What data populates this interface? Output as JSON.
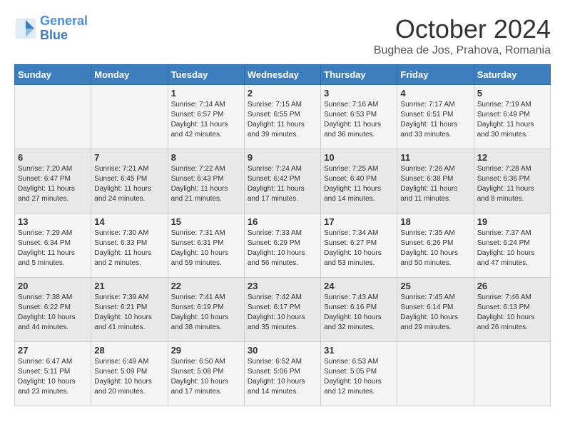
{
  "logo": {
    "line1": "General",
    "line2": "Blue"
  },
  "title": "October 2024",
  "subtitle": "Bughea de Jos, Prahova, Romania",
  "days_header": [
    "Sunday",
    "Monday",
    "Tuesday",
    "Wednesday",
    "Thursday",
    "Friday",
    "Saturday"
  ],
  "weeks": [
    [
      {
        "day": "",
        "info": ""
      },
      {
        "day": "",
        "info": ""
      },
      {
        "day": "1",
        "info": "Sunrise: 7:14 AM\nSunset: 6:57 PM\nDaylight: 11 hours and 42 minutes."
      },
      {
        "day": "2",
        "info": "Sunrise: 7:15 AM\nSunset: 6:55 PM\nDaylight: 11 hours and 39 minutes."
      },
      {
        "day": "3",
        "info": "Sunrise: 7:16 AM\nSunset: 6:53 PM\nDaylight: 11 hours and 36 minutes."
      },
      {
        "day": "4",
        "info": "Sunrise: 7:17 AM\nSunset: 6:51 PM\nDaylight: 11 hours and 33 minutes."
      },
      {
        "day": "5",
        "info": "Sunrise: 7:19 AM\nSunset: 6:49 PM\nDaylight: 11 hours and 30 minutes."
      }
    ],
    [
      {
        "day": "6",
        "info": "Sunrise: 7:20 AM\nSunset: 6:47 PM\nDaylight: 11 hours and 27 minutes."
      },
      {
        "day": "7",
        "info": "Sunrise: 7:21 AM\nSunset: 6:45 PM\nDaylight: 11 hours and 24 minutes."
      },
      {
        "day": "8",
        "info": "Sunrise: 7:22 AM\nSunset: 6:43 PM\nDaylight: 11 hours and 21 minutes."
      },
      {
        "day": "9",
        "info": "Sunrise: 7:24 AM\nSunset: 6:42 PM\nDaylight: 11 hours and 17 minutes."
      },
      {
        "day": "10",
        "info": "Sunrise: 7:25 AM\nSunset: 6:40 PM\nDaylight: 11 hours and 14 minutes."
      },
      {
        "day": "11",
        "info": "Sunrise: 7:26 AM\nSunset: 6:38 PM\nDaylight: 11 hours and 11 minutes."
      },
      {
        "day": "12",
        "info": "Sunrise: 7:28 AM\nSunset: 6:36 PM\nDaylight: 11 hours and 8 minutes."
      }
    ],
    [
      {
        "day": "13",
        "info": "Sunrise: 7:29 AM\nSunset: 6:34 PM\nDaylight: 11 hours and 5 minutes."
      },
      {
        "day": "14",
        "info": "Sunrise: 7:30 AM\nSunset: 6:33 PM\nDaylight: 11 hours and 2 minutes."
      },
      {
        "day": "15",
        "info": "Sunrise: 7:31 AM\nSunset: 6:31 PM\nDaylight: 10 hours and 59 minutes."
      },
      {
        "day": "16",
        "info": "Sunrise: 7:33 AM\nSunset: 6:29 PM\nDaylight: 10 hours and 56 minutes."
      },
      {
        "day": "17",
        "info": "Sunrise: 7:34 AM\nSunset: 6:27 PM\nDaylight: 10 hours and 53 minutes."
      },
      {
        "day": "18",
        "info": "Sunrise: 7:35 AM\nSunset: 6:26 PM\nDaylight: 10 hours and 50 minutes."
      },
      {
        "day": "19",
        "info": "Sunrise: 7:37 AM\nSunset: 6:24 PM\nDaylight: 10 hours and 47 minutes."
      }
    ],
    [
      {
        "day": "20",
        "info": "Sunrise: 7:38 AM\nSunset: 6:22 PM\nDaylight: 10 hours and 44 minutes."
      },
      {
        "day": "21",
        "info": "Sunrise: 7:39 AM\nSunset: 6:21 PM\nDaylight: 10 hours and 41 minutes."
      },
      {
        "day": "22",
        "info": "Sunrise: 7:41 AM\nSunset: 6:19 PM\nDaylight: 10 hours and 38 minutes."
      },
      {
        "day": "23",
        "info": "Sunrise: 7:42 AM\nSunset: 6:17 PM\nDaylight: 10 hours and 35 minutes."
      },
      {
        "day": "24",
        "info": "Sunrise: 7:43 AM\nSunset: 6:16 PM\nDaylight: 10 hours and 32 minutes."
      },
      {
        "day": "25",
        "info": "Sunrise: 7:45 AM\nSunset: 6:14 PM\nDaylight: 10 hours and 29 minutes."
      },
      {
        "day": "26",
        "info": "Sunrise: 7:46 AM\nSunset: 6:13 PM\nDaylight: 10 hours and 26 minutes."
      }
    ],
    [
      {
        "day": "27",
        "info": "Sunrise: 6:47 AM\nSunset: 5:11 PM\nDaylight: 10 hours and 23 minutes."
      },
      {
        "day": "28",
        "info": "Sunrise: 6:49 AM\nSunset: 5:09 PM\nDaylight: 10 hours and 20 minutes."
      },
      {
        "day": "29",
        "info": "Sunrise: 6:50 AM\nSunset: 5:08 PM\nDaylight: 10 hours and 17 minutes."
      },
      {
        "day": "30",
        "info": "Sunrise: 6:52 AM\nSunset: 5:06 PM\nDaylight: 10 hours and 14 minutes."
      },
      {
        "day": "31",
        "info": "Sunrise: 6:53 AM\nSunset: 5:05 PM\nDaylight: 10 hours and 12 minutes."
      },
      {
        "day": "",
        "info": ""
      },
      {
        "day": "",
        "info": ""
      }
    ]
  ]
}
